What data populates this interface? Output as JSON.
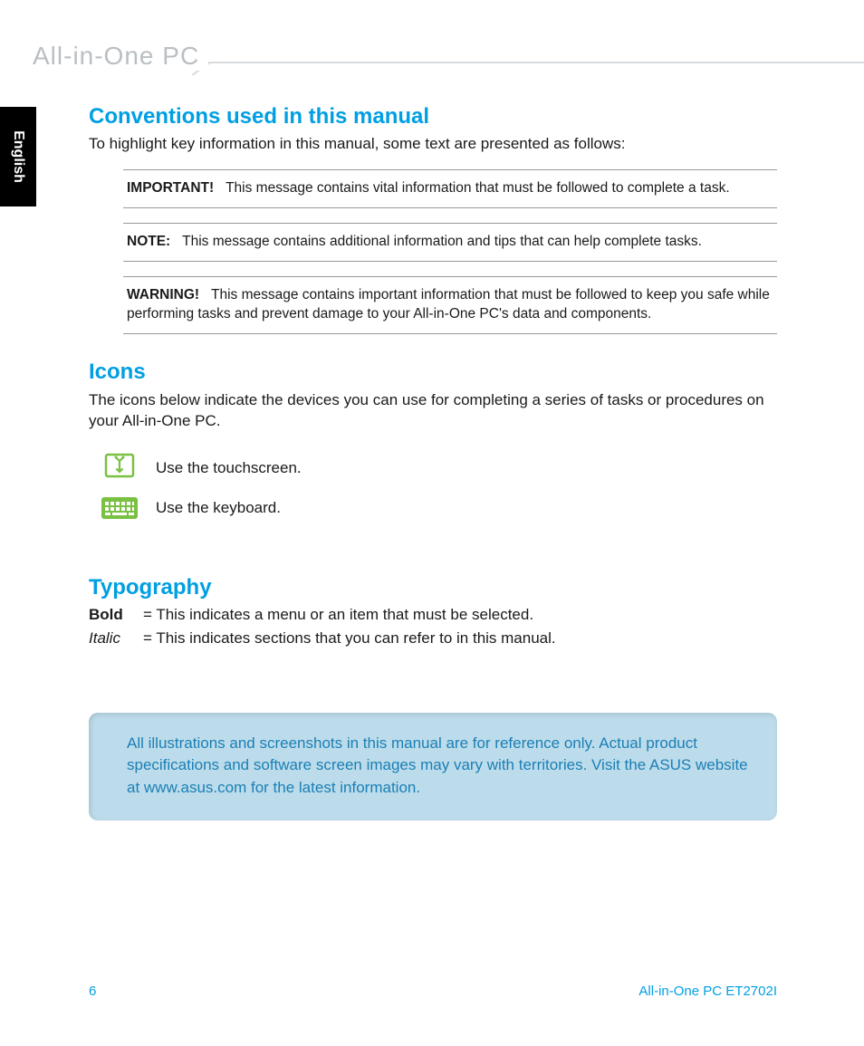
{
  "header": {
    "title": "All-in-One PC"
  },
  "lang_tab": "English",
  "sections": {
    "conventions": {
      "heading": "Conventions used in this manual",
      "intro": "To highlight key information in this manual, some text are presented as follows:",
      "important": {
        "label": "IMPORTANT!",
        "text": "This message contains vital information that must be followed to complete a task."
      },
      "note": {
        "label": "NOTE:",
        "text": "This message contains additional information and tips that can help complete tasks."
      },
      "warning": {
        "label": "WARNING!",
        "text": "This message contains important information that must be followed to keep you safe while performing tasks and prevent damage to your All-in-One PC's data and components."
      }
    },
    "icons": {
      "heading": "Icons",
      "intro": "The icons below indicate the devices you can use for completing a series of tasks or procedures on your All-in-One PC.",
      "items": [
        {
          "icon": "touchscreen-icon",
          "text": "Use the touchscreen."
        },
        {
          "icon": "keyboard-icon",
          "text": "Use the keyboard."
        }
      ]
    },
    "typography": {
      "heading": "Typography",
      "rows": [
        {
          "label": "Bold",
          "desc": "= This indicates a menu or an item that must be selected."
        },
        {
          "label": "Italic",
          "desc": "= This indicates sections that you can refer to in this manual."
        }
      ]
    },
    "infobox": "All illustrations and screenshots in this manual are for reference only. Actual product specifications and software screen images may vary with territories. Visit the ASUS website at www.asus.com for the latest information."
  },
  "footer": {
    "page": "6",
    "model": "All-in-One PC ET2702I"
  }
}
